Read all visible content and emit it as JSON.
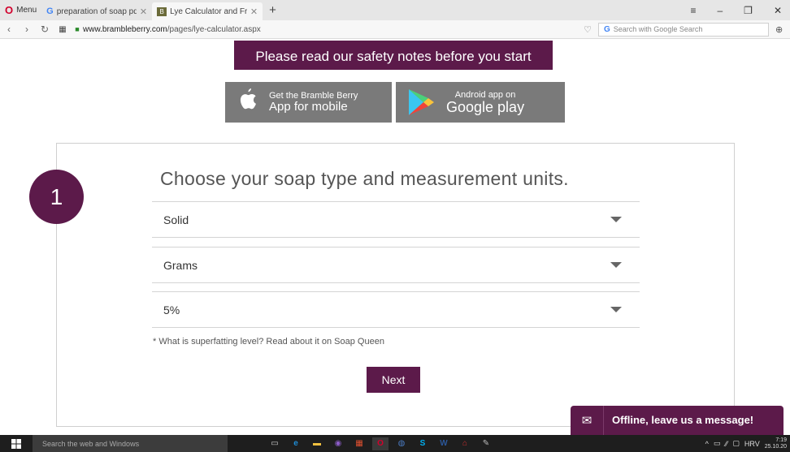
{
  "browser": {
    "menu_label": "Menu",
    "tabs": [
      {
        "label": "preparation of soap pdf - G",
        "favicon": "google-favicon"
      },
      {
        "label": "Lye Calculator and Fragran",
        "favicon": "bramble-berry-favicon"
      }
    ],
    "new_tab_label": "+",
    "url_host": "www.brambleberry.com",
    "url_path": "/pages/lye-calculator.aspx",
    "search_placeholder": "Search with Google Search"
  },
  "page": {
    "safety_banner": "Please read our safety notes before you start",
    "apple_app": {
      "line1": "Get the Bramble Berry",
      "line2": "App for mobile"
    },
    "google_app": {
      "line1": "Android app on",
      "line2": "Google play"
    },
    "step_number": "1",
    "section_title": "Choose your soap type and measurement units.",
    "selects": [
      {
        "value": "Solid"
      },
      {
        "value": "Grams"
      },
      {
        "value": "5%"
      }
    ],
    "superfat_note": "* What is superfatting level?  Read about it on Soap Queen",
    "next_label": "Next",
    "offline_chat_label": "Offline, leave us a message!"
  },
  "taskbar": {
    "search_placeholder": "Search the web and Windows",
    "language": "HRV",
    "time": "7:19",
    "date": "25.10.20"
  },
  "colors": {
    "brand_purple": "#5c1a4a",
    "store_grey": "#7a7a7a"
  }
}
